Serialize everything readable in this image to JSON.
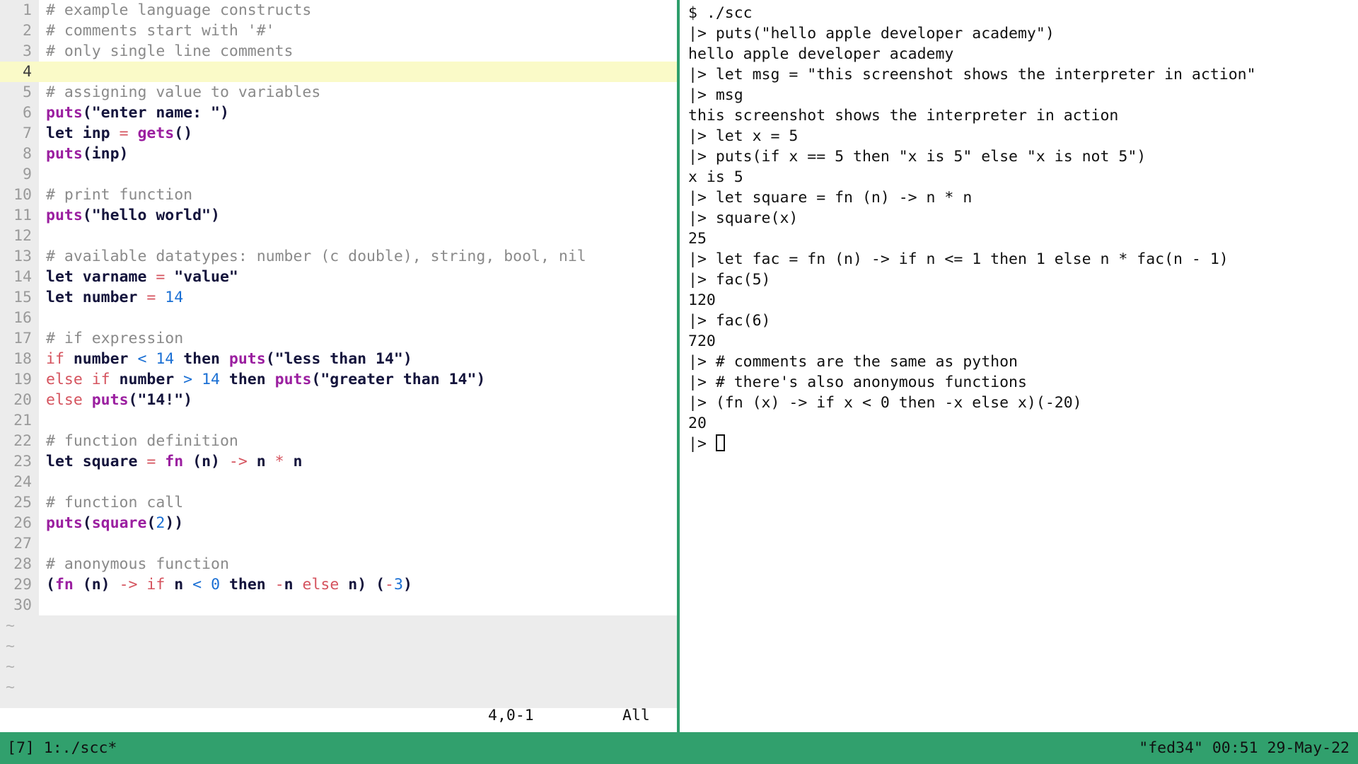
{
  "window": {
    "title": "tmux session with vim and scc REPL"
  },
  "editor": {
    "name": "vim",
    "cursor_line": 4,
    "ruler": {
      "position": "4,0-1",
      "scroll": "All"
    },
    "filler_marker": "~",
    "filler_count": 4,
    "colors": {
      "comment": "#8a8a8a",
      "function": "#9b1fa0",
      "keyword": "#d5535e",
      "number": "#1a6fd4",
      "string": "#14143c",
      "gutter_bg": "#ececec",
      "cursorline_bg": "#fafac8"
    },
    "lines": [
      {
        "n": 1,
        "tokens": [
          {
            "t": "# example language constructs",
            "c": "c-comment"
          }
        ]
      },
      {
        "n": 2,
        "tokens": [
          {
            "t": "# comments start with '#'",
            "c": "c-comment"
          }
        ]
      },
      {
        "n": 3,
        "tokens": [
          {
            "t": "# only single line comments",
            "c": "c-comment"
          }
        ]
      },
      {
        "n": 4,
        "tokens": []
      },
      {
        "n": 5,
        "tokens": [
          {
            "t": "# assigning value to variables",
            "c": "c-comment"
          }
        ]
      },
      {
        "n": 6,
        "tokens": [
          {
            "t": "puts",
            "c": "c-func"
          },
          {
            "t": "(\"enter name: \")",
            "c": "c-str"
          }
        ]
      },
      {
        "n": 7,
        "tokens": [
          {
            "t": "let inp ",
            "c": "c-plain"
          },
          {
            "t": "=",
            "c": "c-op"
          },
          {
            "t": " ",
            "c": "c-plain"
          },
          {
            "t": "gets",
            "c": "c-func"
          },
          {
            "t": "()",
            "c": "c-plain"
          }
        ]
      },
      {
        "n": 8,
        "tokens": [
          {
            "t": "puts",
            "c": "c-func"
          },
          {
            "t": "(inp)",
            "c": "c-plain"
          }
        ]
      },
      {
        "n": 9,
        "tokens": []
      },
      {
        "n": 10,
        "tokens": [
          {
            "t": "# print function",
            "c": "c-comment"
          }
        ]
      },
      {
        "n": 11,
        "tokens": [
          {
            "t": "puts",
            "c": "c-func"
          },
          {
            "t": "(\"hello world\")",
            "c": "c-str"
          }
        ]
      },
      {
        "n": 12,
        "tokens": []
      },
      {
        "n": 13,
        "tokens": [
          {
            "t": "# available datatypes: number (c double), string, bool, nil",
            "c": "c-comment"
          }
        ]
      },
      {
        "n": 14,
        "tokens": [
          {
            "t": "let varname ",
            "c": "c-plain"
          },
          {
            "t": "=",
            "c": "c-op"
          },
          {
            "t": " ",
            "c": "c-plain"
          },
          {
            "t": "\"value\"",
            "c": "c-str"
          }
        ]
      },
      {
        "n": 15,
        "tokens": [
          {
            "t": "let number ",
            "c": "c-plain"
          },
          {
            "t": "=",
            "c": "c-op"
          },
          {
            "t": " ",
            "c": "c-plain"
          },
          {
            "t": "14",
            "c": "c-num"
          }
        ]
      },
      {
        "n": 16,
        "tokens": []
      },
      {
        "n": 17,
        "tokens": [
          {
            "t": "# if expression",
            "c": "c-comment"
          }
        ]
      },
      {
        "n": 18,
        "tokens": [
          {
            "t": "if",
            "c": "c-kw"
          },
          {
            "t": " number ",
            "c": "c-plain"
          },
          {
            "t": "<",
            "c": "c-cmp"
          },
          {
            "t": " ",
            "c": "c-plain"
          },
          {
            "t": "14",
            "c": "c-num"
          },
          {
            "t": " then ",
            "c": "c-plain"
          },
          {
            "t": "puts",
            "c": "c-func"
          },
          {
            "t": "(\"less than 14\")",
            "c": "c-str"
          }
        ]
      },
      {
        "n": 19,
        "tokens": [
          {
            "t": "else if",
            "c": "c-kw"
          },
          {
            "t": " number ",
            "c": "c-plain"
          },
          {
            "t": ">",
            "c": "c-cmp"
          },
          {
            "t": " ",
            "c": "c-plain"
          },
          {
            "t": "14",
            "c": "c-num"
          },
          {
            "t": " then ",
            "c": "c-plain"
          },
          {
            "t": "puts",
            "c": "c-func"
          },
          {
            "t": "(\"greater than 14\")",
            "c": "c-str"
          }
        ]
      },
      {
        "n": 20,
        "tokens": [
          {
            "t": "else",
            "c": "c-kw"
          },
          {
            "t": " ",
            "c": "c-plain"
          },
          {
            "t": "puts",
            "c": "c-func"
          },
          {
            "t": "(\"14!\")",
            "c": "c-str"
          }
        ]
      },
      {
        "n": 21,
        "tokens": []
      },
      {
        "n": 22,
        "tokens": [
          {
            "t": "# function definition",
            "c": "c-comment"
          }
        ]
      },
      {
        "n": 23,
        "tokens": [
          {
            "t": "let square ",
            "c": "c-plain"
          },
          {
            "t": "=",
            "c": "c-op"
          },
          {
            "t": " ",
            "c": "c-plain"
          },
          {
            "t": "fn",
            "c": "c-func"
          },
          {
            "t": " (n) ",
            "c": "c-plain"
          },
          {
            "t": "->",
            "c": "c-op"
          },
          {
            "t": " n ",
            "c": "c-plain"
          },
          {
            "t": "*",
            "c": "c-op"
          },
          {
            "t": " n",
            "c": "c-plain"
          }
        ]
      },
      {
        "n": 24,
        "tokens": []
      },
      {
        "n": 25,
        "tokens": [
          {
            "t": "# function call",
            "c": "c-comment"
          }
        ]
      },
      {
        "n": 26,
        "tokens": [
          {
            "t": "puts",
            "c": "c-func"
          },
          {
            "t": "(",
            "c": "c-plain"
          },
          {
            "t": "square",
            "c": "c-func"
          },
          {
            "t": "(",
            "c": "c-plain"
          },
          {
            "t": "2",
            "c": "c-num"
          },
          {
            "t": "))",
            "c": "c-plain"
          }
        ]
      },
      {
        "n": 27,
        "tokens": []
      },
      {
        "n": 28,
        "tokens": [
          {
            "t": "# anonymous function",
            "c": "c-comment"
          }
        ]
      },
      {
        "n": 29,
        "tokens": [
          {
            "t": "(",
            "c": "c-plain"
          },
          {
            "t": "fn",
            "c": "c-func"
          },
          {
            "t": " (n) ",
            "c": "c-plain"
          },
          {
            "t": "->",
            "c": "c-op"
          },
          {
            "t": " ",
            "c": "c-plain"
          },
          {
            "t": "if",
            "c": "c-kw"
          },
          {
            "t": " n ",
            "c": "c-plain"
          },
          {
            "t": "<",
            "c": "c-cmp"
          },
          {
            "t": " ",
            "c": "c-plain"
          },
          {
            "t": "0",
            "c": "c-num"
          },
          {
            "t": " then ",
            "c": "c-plain"
          },
          {
            "t": "-",
            "c": "c-op"
          },
          {
            "t": "n ",
            "c": "c-plain"
          },
          {
            "t": "else",
            "c": "c-kw"
          },
          {
            "t": " n) (",
            "c": "c-plain"
          },
          {
            "t": "-",
            "c": "c-op"
          },
          {
            "t": "3",
            "c": "c-num"
          },
          {
            "t": ")",
            "c": "c-plain"
          }
        ]
      },
      {
        "n": 30,
        "tokens": []
      }
    ]
  },
  "repl": {
    "program": "./scc",
    "prompt": "|>",
    "shell_prompt": "$",
    "lines": [
      {
        "kind": "shell",
        "text": "$ ./scc"
      },
      {
        "kind": "input",
        "text": "|> puts(\"hello apple developer academy\")"
      },
      {
        "kind": "output",
        "text": "hello apple developer academy"
      },
      {
        "kind": "input",
        "text": "|> let msg = \"this screenshot shows the interpreter in action\""
      },
      {
        "kind": "input",
        "text": "|> msg"
      },
      {
        "kind": "output",
        "text": "this screenshot shows the interpreter in action"
      },
      {
        "kind": "input",
        "text": "|> let x = 5"
      },
      {
        "kind": "input",
        "text": "|> puts(if x == 5 then \"x is 5\" else \"x is not 5\")"
      },
      {
        "kind": "output",
        "text": "x is 5"
      },
      {
        "kind": "input",
        "text": "|> let square = fn (n) -> n * n"
      },
      {
        "kind": "input",
        "text": "|> square(x)"
      },
      {
        "kind": "output",
        "text": "25"
      },
      {
        "kind": "input",
        "text": "|> let fac = fn (n) -> if n <= 1 then 1 else n * fac(n - 1)"
      },
      {
        "kind": "input",
        "text": "|> fac(5)"
      },
      {
        "kind": "output",
        "text": "120"
      },
      {
        "kind": "input",
        "text": "|> fac(6)"
      },
      {
        "kind": "output",
        "text": "720"
      },
      {
        "kind": "input",
        "text": "|> # comments are the same as python"
      },
      {
        "kind": "input",
        "text": "|> # there's also anonymous functions"
      },
      {
        "kind": "input",
        "text": "|> (fn (x) -> if x < 0 then -x else x)(-20)"
      },
      {
        "kind": "output",
        "text": "20"
      }
    ],
    "active_prompt": "|>"
  },
  "status_bar": {
    "background": "#31a06d",
    "left": "[7] 1:./scc*",
    "right": "\"fed34\" 00:51 29-May-22"
  }
}
